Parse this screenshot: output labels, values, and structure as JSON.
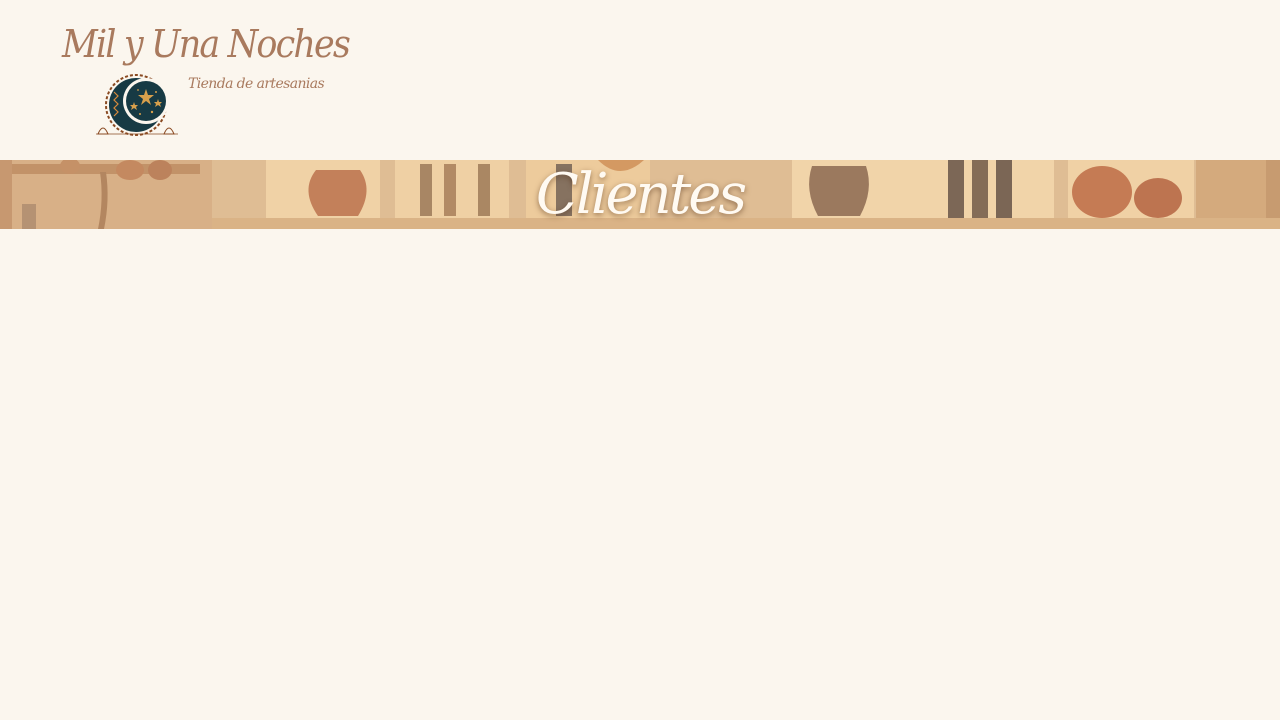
{
  "brand": {
    "name": "Mil y Una Noches",
    "tagline": "Tienda de artesanias",
    "logo_icon": "crescent-moon-stars-icon"
  },
  "banner": {
    "title": "Clientes"
  },
  "colors": {
    "background": "#fbf6ee",
    "brand_text": "#a97a5e",
    "logo_dark": "#173a44",
    "logo_accent": "#8a4a22",
    "banner_title": "#fffaf2"
  }
}
